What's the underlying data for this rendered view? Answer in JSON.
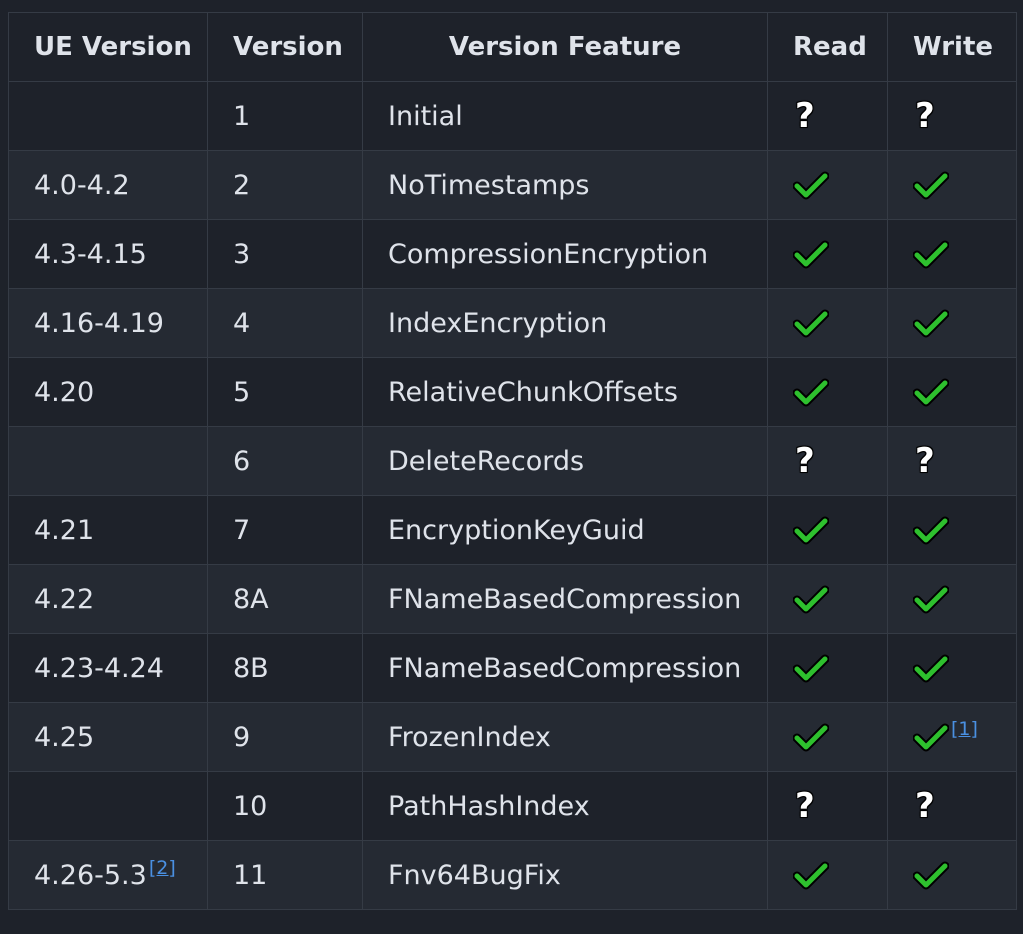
{
  "headers": [
    "UE Version",
    "Version",
    "Version Feature",
    "Read",
    "Write"
  ],
  "colors": {
    "check": "#2ec02e",
    "question": "#ffffff",
    "link": "#4a90e2"
  },
  "rows": [
    {
      "ue": "",
      "version": "1",
      "feature": "Initial",
      "read": "question",
      "write": "question"
    },
    {
      "ue": "4.0-4.2",
      "version": "2",
      "feature": "NoTimestamps",
      "read": "check",
      "write": "check"
    },
    {
      "ue": "4.3-4.15",
      "version": "3",
      "feature": "CompressionEncryption",
      "read": "check",
      "write": "check"
    },
    {
      "ue": "4.16-4.19",
      "version": "4",
      "feature": "IndexEncryption",
      "read": "check",
      "write": "check"
    },
    {
      "ue": "4.20",
      "version": "5",
      "feature": "RelativeChunkOffsets",
      "read": "check",
      "write": "check"
    },
    {
      "ue": "",
      "version": "6",
      "feature": "DeleteRecords",
      "read": "question",
      "write": "question"
    },
    {
      "ue": "4.21",
      "version": "7",
      "feature": "EncryptionKeyGuid",
      "read": "check",
      "write": "check"
    },
    {
      "ue": "4.22",
      "version": "8A",
      "feature": "FNameBasedCompression",
      "read": "check",
      "write": "check"
    },
    {
      "ue": "4.23-4.24",
      "version": "8B",
      "feature": "FNameBasedCompression",
      "read": "check",
      "write": "check"
    },
    {
      "ue": "4.25",
      "version": "9",
      "feature": "FrozenIndex",
      "read": "check",
      "write": "check",
      "write_footnote": "[1]"
    },
    {
      "ue": "",
      "version": "10",
      "feature": "PathHashIndex",
      "read": "question",
      "write": "question"
    },
    {
      "ue": "4.26-5.3",
      "ue_footnote": "[2]",
      "version": "11",
      "feature": "Fnv64BugFix",
      "read": "check",
      "write": "check"
    }
  ]
}
